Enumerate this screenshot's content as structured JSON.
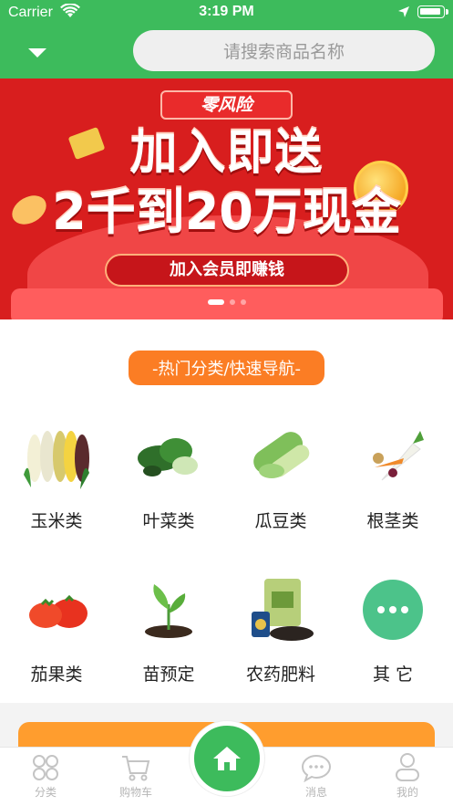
{
  "status_bar": {
    "carrier": "Carrier",
    "time": "3:19 PM"
  },
  "header": {
    "search_placeholder": "请搜索商品名称"
  },
  "banner": {
    "badge": "零风险",
    "headline_1": "加入即送",
    "headline_2": "2千到20万现金",
    "cta": "加入会员即赚钱",
    "slides": 3,
    "active_slide": 1
  },
  "categories": {
    "header": "-热门分类/快速导航-",
    "items": [
      {
        "label": "玉米类",
        "icon": "corn-icon"
      },
      {
        "label": "叶菜类",
        "icon": "leafy-greens-icon"
      },
      {
        "label": "瓜豆类",
        "icon": "gourd-icon"
      },
      {
        "label": "根茎类",
        "icon": "root-vegetable-icon"
      },
      {
        "label": "茄果类",
        "icon": "tomato-icon"
      },
      {
        "label": "苗预定",
        "icon": "seedling-icon"
      },
      {
        "label": "农药肥料",
        "icon": "fertilizer-icon"
      },
      {
        "label": "其 它",
        "icon": "more-icon"
      }
    ]
  },
  "tabbar": {
    "items": [
      {
        "label": "分类",
        "icon": "category-icon"
      },
      {
        "label": "购物车",
        "icon": "cart-icon"
      },
      {
        "label": "",
        "icon": "home-icon"
      },
      {
        "label": "消息",
        "icon": "message-icon"
      },
      {
        "label": "我的",
        "icon": "profile-icon"
      }
    ]
  },
  "colors": {
    "brand_green": "#3dbb5c",
    "accent_orange": "#fb7d24",
    "banner_red": "#d81e1e"
  }
}
